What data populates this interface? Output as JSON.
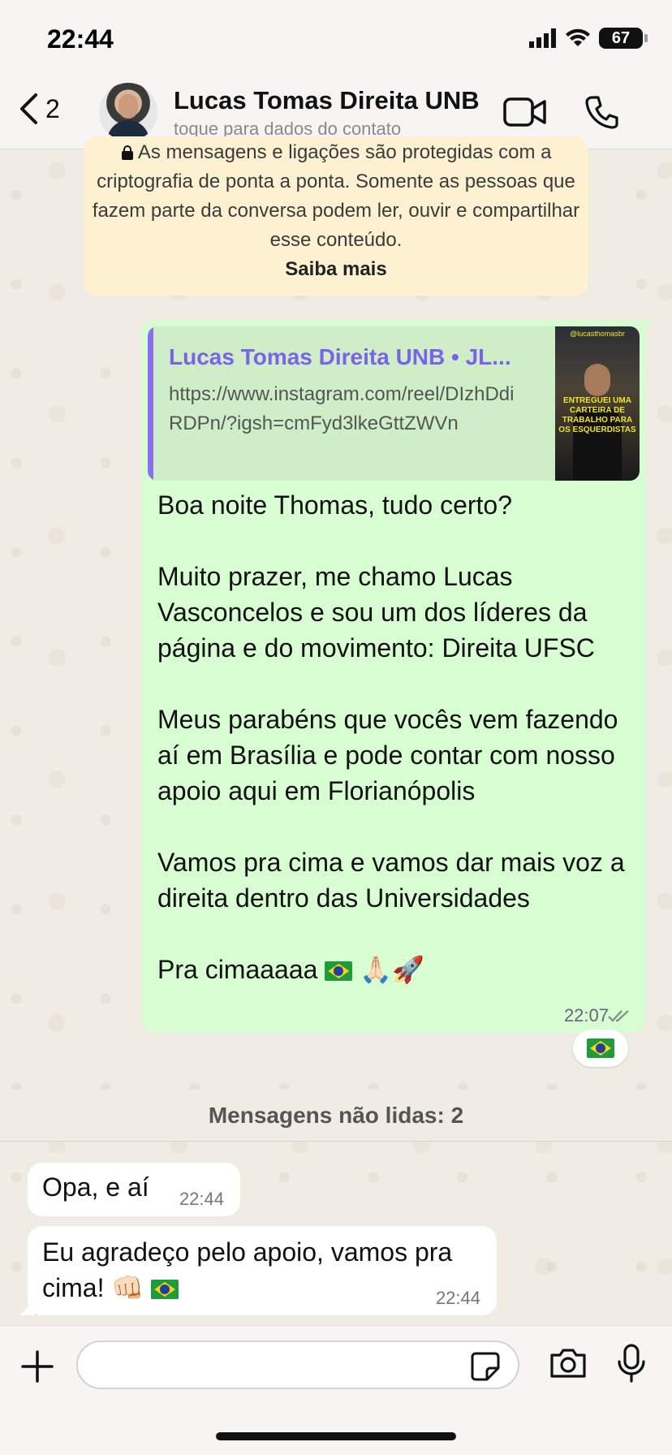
{
  "status_bar": {
    "time": "22:44",
    "battery": "67"
  },
  "header": {
    "back_count": "2",
    "contact_name": "Lucas Tomas Direita UNB",
    "contact_subtitle": "toque para dados do contato"
  },
  "encryption_notice": {
    "text": "As mensagens e ligações são protegidas com a criptografia de ponta a ponta. Somente as pessoas que fazem parte da conversa podem ler, ouvir e compartilhar esse conteúdo.",
    "link": "Saiba mais"
  },
  "outgoing_message": {
    "link_preview": {
      "title": "Lucas Tomas Direita UNB • JL...",
      "url": "https://www.instagram.com/reel/DIzhDdiRDPn/?igsh=cmFyd3lkeGttZWVn",
      "thumb_handle": "@lucasthomasbr",
      "thumb_caption": "ENTREGUEI UMA CARTEIRA DE TRABALHO PARA OS ESQUERDISTAS"
    },
    "text": "Boa noite Thomas, tudo certo?\n\nMuito prazer, me chamo Lucas Vasconcelos e sou um dos líderes da página e do movimento: Direita UFSC\n\nMeus parabéns que vocês vem fazendo aí em Brasília e pode contar com nosso apoio aqui em Florianópolis\n\nVamos pra cima e vamos dar mais voz a direita dentro das Universidades\n\nPra cimaaaaa",
    "emoji_tail": "🙏🏻🚀",
    "time": "22:07",
    "status": "read"
  },
  "unread_divider": "Mensagens não lidas: 2",
  "incoming_messages": [
    {
      "text": "Opa, e aí",
      "time": "22:44"
    },
    {
      "text": "Eu agradeço pelo apoio, vamos pra cima! 👊🏻",
      "time": "22:44"
    }
  ],
  "colors": {
    "outgoing_bubble": "#d9fdd3",
    "incoming_bubble": "#ffffff",
    "link_title": "#7a63e8",
    "encryption_bg": "#fdf1d1"
  }
}
